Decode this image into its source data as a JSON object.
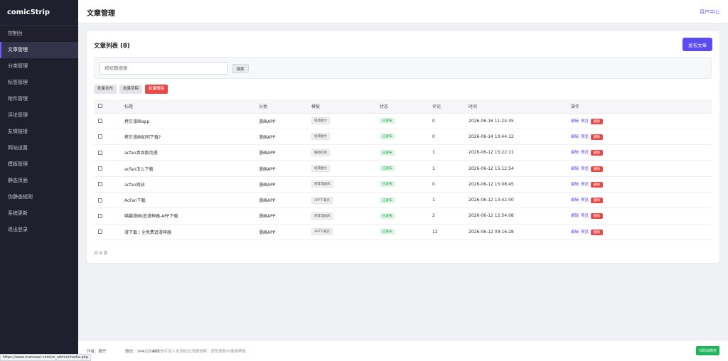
{
  "sidebar": {
    "logo": "comicStrip",
    "items": [
      {
        "label": "控制台"
      },
      {
        "label": "文章管理"
      },
      {
        "label": "分类管理"
      },
      {
        "label": "标签管理"
      },
      {
        "label": "附件管理"
      },
      {
        "label": "评论管理"
      },
      {
        "label": "友情链接"
      },
      {
        "label": "网站设置"
      },
      {
        "label": "模板管理"
      },
      {
        "label": "静态页面"
      },
      {
        "label": "伪静态规则"
      },
      {
        "label": "系统更新"
      },
      {
        "label": "退出登录"
      }
    ]
  },
  "header": {
    "title": "文章管理",
    "user_center": "用户中心"
  },
  "card": {
    "title": "文章列表 (8)",
    "publish_label": "发布文章"
  },
  "search": {
    "placeholder": "按标题搜索",
    "button_label": "搜索"
  },
  "bulk": {
    "publish_label": "批量发布",
    "draft_label": "批量草稿",
    "delete_label": "批量删除"
  },
  "table": {
    "headers": {
      "title": "标题",
      "category": "分类",
      "template": "模板",
      "status": "状态",
      "comments": "评论",
      "time": "时间",
      "ops": "操作"
    },
    "op_labels": {
      "edit": "编辑",
      "preview": "预览",
      "delete": "删除"
    },
    "rows": [
      {
        "title": "拷贝漫画app",
        "category": "漫画APP",
        "template": "经典图文",
        "status": "已发布",
        "comments": "0",
        "time": "2026-06-16 11:24:35"
      },
      {
        "title": "拷贝漫画如何下载?",
        "category": "漫画APP",
        "template": "经典图文",
        "status": "已发布",
        "comments": "0",
        "time": "2026-06-14 10:44:12"
      },
      {
        "title": "acfan真血版动漫",
        "category": "漫画APP",
        "template": "横图栏目",
        "status": "已发布",
        "comments": "1",
        "time": "2026-06-12 15:22:11"
      },
      {
        "title": "acfan怎么下载",
        "category": "漫画APP",
        "template": "经典图文",
        "status": "已发布",
        "comments": "1",
        "time": "2026-06-12 15:12:54"
      },
      {
        "title": "acfan网站",
        "category": "漫画APP",
        "template": "烤茸漫画风",
        "status": "已发布",
        "comments": "0",
        "time": "2026-06-12 15:08:45"
      },
      {
        "title": "AcFan下载",
        "category": "漫画APP",
        "template": "APP下载页",
        "status": "已发布",
        "comments": "1",
        "time": "2026-06-12 13:42:50"
      },
      {
        "title": "喵趣漫画|追漫神器-APP下载",
        "category": "漫画APP",
        "template": "烤茸漫画风",
        "status": "已发布",
        "comments": "2",
        "time": "2026-06-12 12:54:08"
      },
      {
        "title": "漫下载 | 全免费追漫神器",
        "category": "漫画APP",
        "template": "APP下载页",
        "status": "已发布",
        "comments": "12",
        "time": "2026-06-12 09:16:28"
      }
    ]
  },
  "total": "共 8 条",
  "footer": {
    "author": "作者：鹏仔",
    "wechat": "微信：344225443",
    "note": "加微信可加入本源码交流微信群，获取更新与使用帮助",
    "button_label": "扫码加微信"
  },
  "status_bar_url": "https://www.manxiaxi.com/cs_admin/media.php"
}
